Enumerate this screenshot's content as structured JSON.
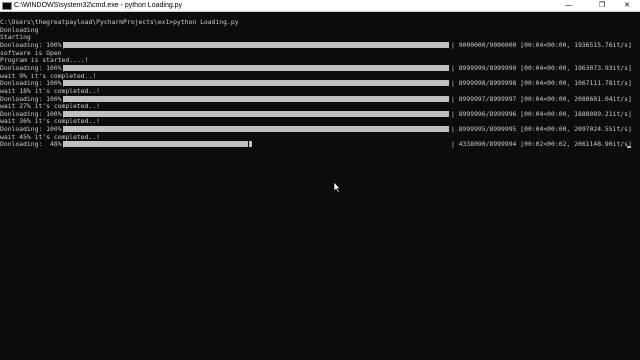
{
  "window": {
    "title": "C:\\WINDOWS\\system32\\cmd.exe - python  Loading.py",
    "min_glyph": "—",
    "max_glyph": "❐",
    "close_glyph": "✕"
  },
  "console": {
    "lines": [
      {
        "text": "C:\\Users\\thegreatpayload\\PycharmProjects\\ex1>python Loading.py"
      },
      {
        "text": "Donloading"
      },
      {
        "text": "Starting"
      },
      {
        "text": "Donloading: 100%|",
        "progress": 1.0,
        "stats": "| 9000000/9000000 [00:04<00:00, 1936515.76it/s]"
      },
      {
        "text": "software is Open"
      },
      {
        "text": "Program is started....!"
      },
      {
        "text": "Donloading: 100%|",
        "progress": 1.0,
        "stats": "| 8999999/8999999 [00:04<00:00, 1963073.93it/s]"
      },
      {
        "text": "wait 9% it's completed..!"
      },
      {
        "text": "Donloading: 100%|",
        "progress": 1.0,
        "stats": "| 8999998/8999998 [00:04<00:00, 1067111.78it/s]"
      },
      {
        "text": "wait 18% it's completed..!"
      },
      {
        "text": "Donloading: 100%|",
        "progress": 1.0,
        "stats": "| 8999997/8999997 [00:04<00:00, 2080601.04it/s]"
      },
      {
        "text": "wait 27% it's completed..!"
      },
      {
        "text": "Donloading: 100%|",
        "progress": 1.0,
        "stats": "| 8999996/8999996 [00:04<00:00, 1888089.21it/s]"
      },
      {
        "text": "wait 36% it's completed..!"
      },
      {
        "text": "Donloading: 100%|",
        "progress": 1.0,
        "stats": "| 8999995/8999995 [00:04<00:00, 2097024.55it/s]"
      },
      {
        "text": "wait 45% it's completed..!"
      },
      {
        "text": "Donloading:  48%|",
        "progress": 0.48,
        "stats": "| 4338090/8999994 [00:02<00:02, 2061148.90it/s]",
        "cursor": true
      }
    ]
  },
  "colors": {
    "background": "#0c0c0c",
    "text": "#cccccc",
    "bar": "#c0c0c0"
  },
  "icons": {
    "mouse": "mouse-pointer-icon"
  }
}
